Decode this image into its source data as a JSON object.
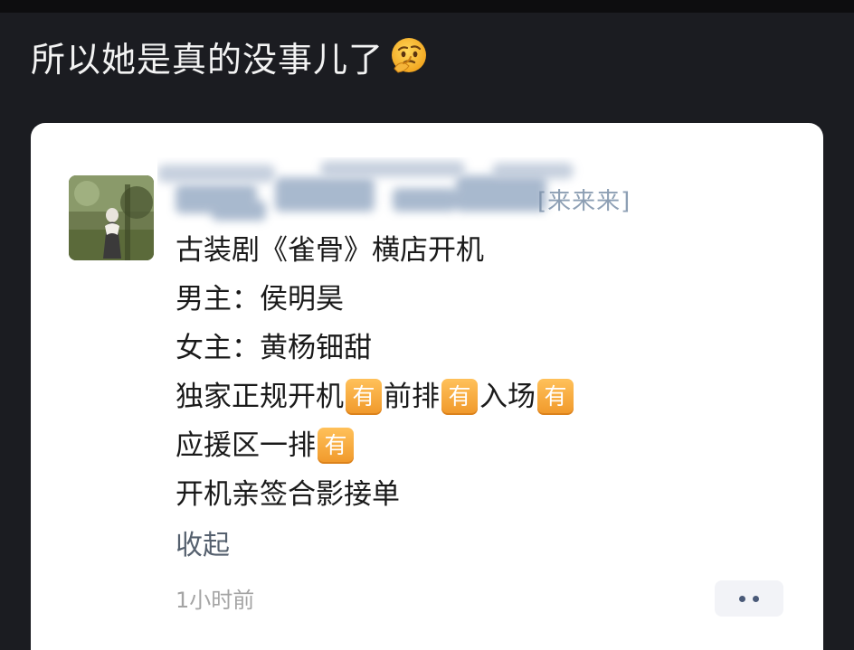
{
  "headline": {
    "text": "所以她是真的没事儿了",
    "emoji_icon": "thinking-face-icon"
  },
  "post": {
    "author_name_suffix": "[来来来]",
    "lines": [
      {
        "text": "古装剧《雀骨》横店开机"
      },
      {
        "text": "男主：侯明昊"
      },
      {
        "text": "女主：黄杨钿甜"
      },
      {
        "segments": [
          "独家正规开机",
          "前排",
          "入场"
        ],
        "badge_label": "有"
      },
      {
        "segments": [
          "应援区一排"
        ],
        "badge_label": "有"
      },
      {
        "text": "开机亲签合影接单"
      }
    ],
    "collapse_label": "收起",
    "timestamp": "1小时前"
  },
  "icons": {
    "avatar": "avatar-image",
    "more": "more-dots-icon",
    "badge": "you-badge-icon"
  },
  "colors": {
    "page_background": "#1b1c21",
    "card_background": "#ffffff",
    "link_text": "#55606e",
    "badge": "#f0982a"
  }
}
